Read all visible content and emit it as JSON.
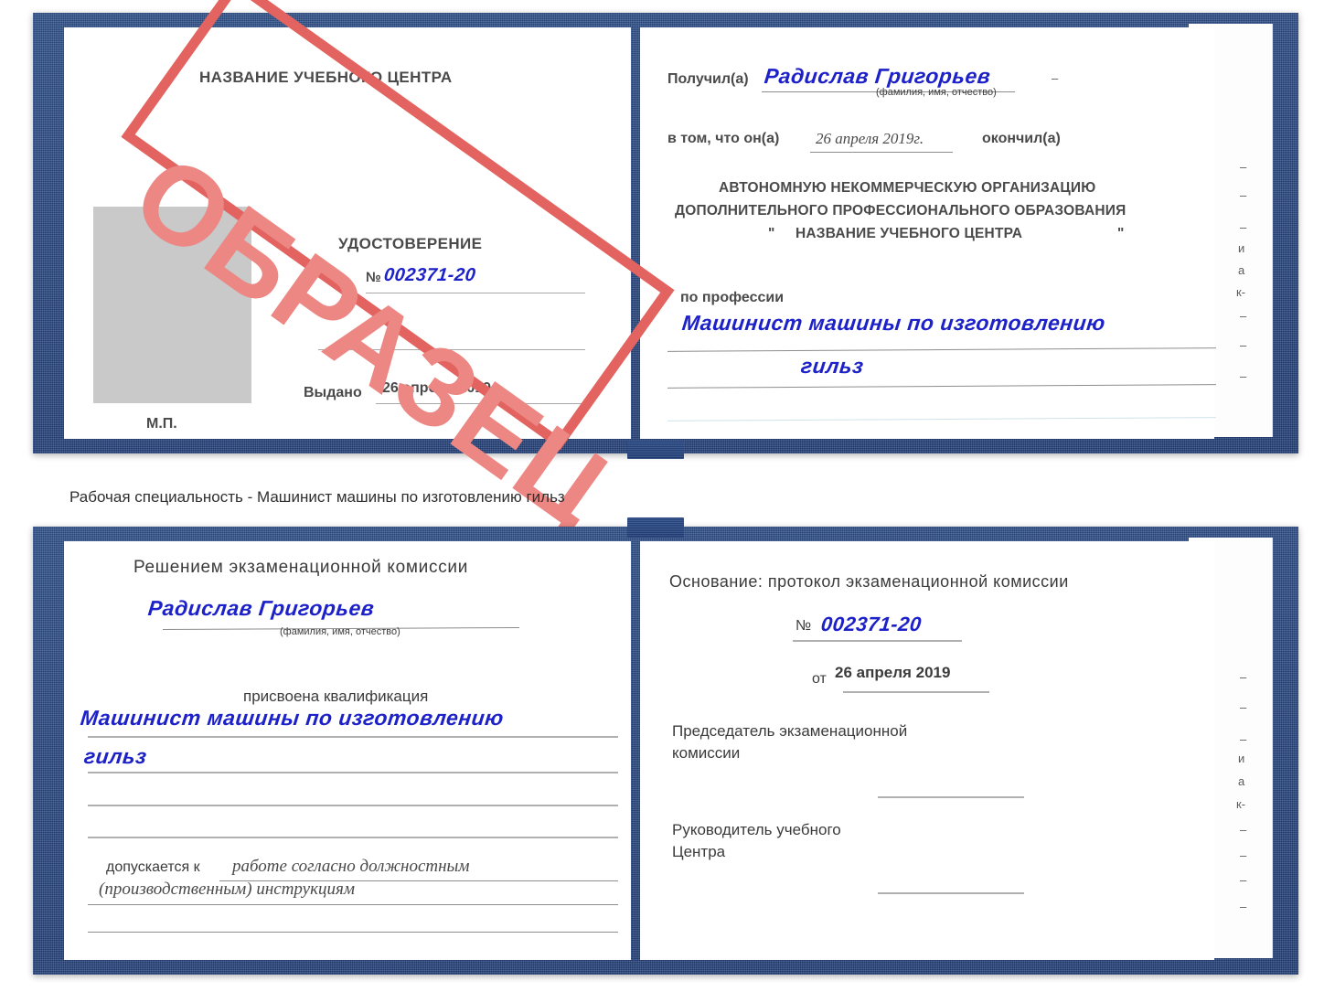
{
  "caption": "Рабочая специальность - Машинист машины по изготовлению гильз",
  "stamp": {
    "text": "ОБРАЗЕЦ",
    "color": "#e2635f"
  },
  "certificate_top": {
    "left_page": {
      "center_name": "НАЗВАНИЕ УЧЕБНОГО ЦЕНТРА",
      "doc_type": "УДОСТОВЕРЕНИЕ",
      "number_label": "№",
      "number_value": "002371-20",
      "issued_label": "Выдано",
      "issued_value": "26 апреля 2019",
      "seal_label": "М.П."
    },
    "right_page": {
      "received_label": "Получил(а)",
      "received_value": "Радислав Григорьев",
      "name_hint": "(фамилия, имя, отчество)",
      "in_that_label": "в том, что он(а)",
      "completion_date": "26 апреля 2019г.",
      "finished_label": "окончил(а)",
      "org_line1": "АВТОНОМНУЮ НЕКОММЕРЧЕСКУЮ ОРГАНИЗАЦИЮ",
      "org_line2": "ДОПОЛНИТЕЛЬНОГО ПРОФЕССИОНАЛЬНОГО ОБРАЗОВАНИЯ",
      "org_quote_open": "\"",
      "org_line3": "НАЗВАНИЕ УЧЕБНОГО ЦЕНТРА",
      "org_quote_close": "\"",
      "profession_label": "по профессии",
      "profession_value_line1": "Машинист машины по изготовлению",
      "profession_value_line2": "гильз",
      "edge_marks": [
        "–",
        "–",
        "–",
        "и",
        "а",
        "к-",
        "–",
        "–",
        "–"
      ]
    }
  },
  "certificate_bottom": {
    "left_page": {
      "decision_title": "Решением экзаменационной комиссии",
      "name_value": "Радислав Григорьев",
      "name_hint": "(фамилия, имя, отчество)",
      "qualification_label": "присвоена квалификация",
      "qualification_line1": "Машинист машины по изготовлению",
      "qualification_line2": "гильз",
      "admitted_label": "допускается к",
      "admitted_value_line1": "работе согласно должностным",
      "admitted_value_line2": "(производственным) инструкциям"
    },
    "right_page": {
      "basis_label": "Основание: протокол экзаменационной комиссии",
      "number_label": "№",
      "number_value": "002371-20",
      "date_label": "от",
      "date_value": "26 апреля 2019",
      "chairman_line1": "Председатель экзаменационной",
      "chairman_line2": "комиссии",
      "head_line1": "Руководитель учебного",
      "head_line2": "Центра",
      "edge_marks": [
        "–",
        "–",
        "–",
        "и",
        "а",
        "к-",
        "–",
        "–",
        "–",
        "–"
      ]
    }
  },
  "colors": {
    "cover_blue": "#2a4a86",
    "ink_blue": "#1d21c8",
    "stamp_red": "#e2635f",
    "photo_gray": "#c9c9c9",
    "text_gray": "#4a4a4a"
  }
}
